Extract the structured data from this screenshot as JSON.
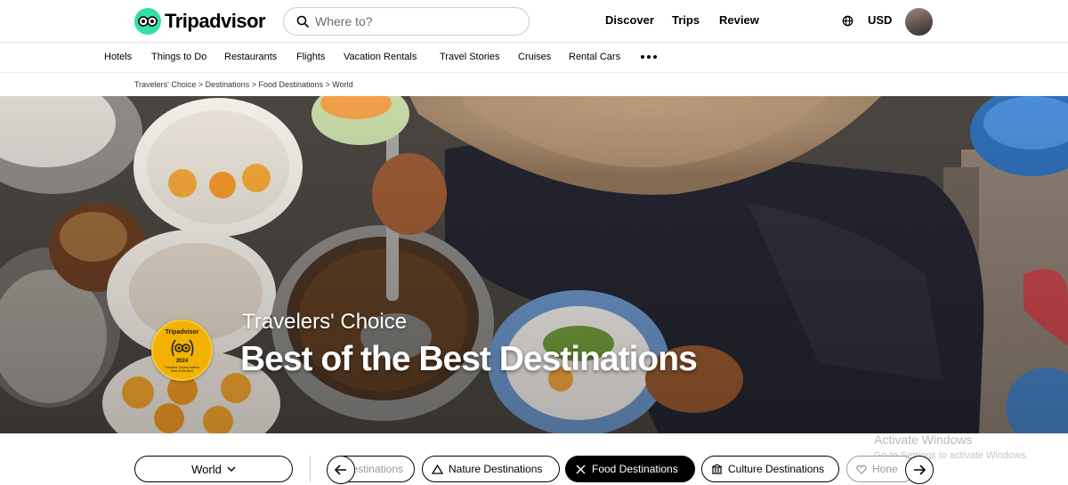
{
  "header": {
    "logo_text": "Tripadvisor",
    "search_placeholder": "Where to?",
    "nav": [
      "Discover",
      "Trips",
      "Review"
    ],
    "currency": "USD"
  },
  "subnav": {
    "items": [
      "Hotels",
      "Things to Do",
      "Restaurants",
      "Flights",
      "Vacation Rentals",
      "Travel Stories",
      "Cruises",
      "Rental Cars"
    ]
  },
  "breadcrumb": "Travelers' Choice > Destinations > Food Destinations > World",
  "hero": {
    "eyebrow": "Travelers' Choice",
    "title": "Best of the Best Destinations",
    "badge": {
      "brand": "Tripadvisor",
      "year": "2024",
      "ring_text": "Travelers' Choice Awards Best of the Best"
    }
  },
  "filters": {
    "region": "World",
    "chips": [
      {
        "label": "Destinations",
        "icon": "partial"
      },
      {
        "label": "Nature Destinations",
        "icon": "mountain-icon"
      },
      {
        "label": "Food Destinations",
        "icon": "utensils-icon",
        "active": true
      },
      {
        "label": "Culture Destinations",
        "icon": "museum-icon"
      },
      {
        "label": "Hone",
        "icon": "heart-icon"
      }
    ]
  },
  "watermark": {
    "title": "Activate Windows",
    "subtitle": "Go to Settings to activate Windows."
  },
  "colors": {
    "brand_green": "#34e0a1",
    "badge_gold": "#f2b203",
    "active_chip": "#000000"
  }
}
